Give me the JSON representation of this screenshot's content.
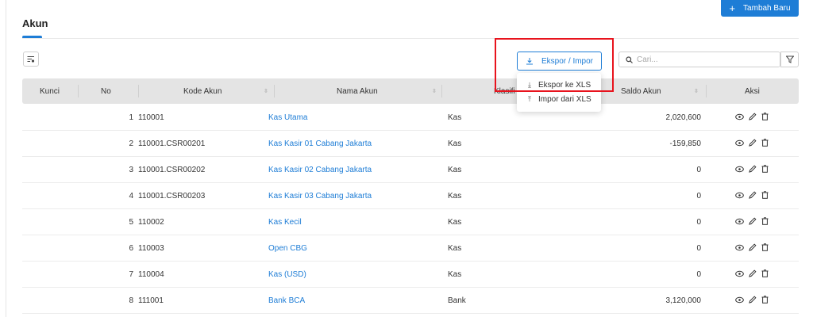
{
  "header": {
    "add_button_label": "Tambah Baru",
    "page_title": "Akun"
  },
  "toolbar": {
    "export_label": "Ekspor / Impor",
    "search_placeholder": "Cari..."
  },
  "dropdown": {
    "items": [
      {
        "label": "Ekspor ke XLS"
      },
      {
        "label": "Impor dari XLS"
      }
    ]
  },
  "table": {
    "columns": {
      "kunci": "Kunci",
      "no": "No",
      "kode": "Kode Akun",
      "nama": "Nama Akun",
      "klasifikasi": "Klasifi",
      "saldo": "Saldo Akun",
      "aksi": "Aksi"
    },
    "rows": [
      {
        "no": "1",
        "kode": "110001",
        "nama": "Kas Utama",
        "klasifikasi": "Kas",
        "saldo": "2,020,600"
      },
      {
        "no": "2",
        "kode": "110001.CSR00201",
        "nama": "Kas Kasir 01 Cabang Jakarta",
        "klasifikasi": "Kas",
        "saldo": "-159,850"
      },
      {
        "no": "3",
        "kode": "110001.CSR00202",
        "nama": "Kas Kasir 02 Cabang Jakarta",
        "klasifikasi": "Kas",
        "saldo": "0"
      },
      {
        "no": "4",
        "kode": "110001.CSR00203",
        "nama": "Kas Kasir 03 Cabang Jakarta",
        "klasifikasi": "Kas",
        "saldo": "0"
      },
      {
        "no": "5",
        "kode": "110002",
        "nama": "Kas Kecil",
        "klasifikasi": "Kas",
        "saldo": "0"
      },
      {
        "no": "6",
        "kode": "110003",
        "nama": "Open CBG",
        "klasifikasi": "Kas",
        "saldo": "0"
      },
      {
        "no": "7",
        "kode": "110004",
        "nama": "Kas (USD)",
        "klasifikasi": "Kas",
        "saldo": "0"
      },
      {
        "no": "8",
        "kode": "111001",
        "nama": "Bank BCA",
        "klasifikasi": "Bank",
        "saldo": "3,120,000"
      }
    ]
  },
  "colors": {
    "accent": "#1e7dd6",
    "highlight": "#e8131d",
    "header_bg": "#e4e4e4"
  },
  "icons": [
    "plus-icon",
    "filter-list-icon",
    "download-icon",
    "search-icon",
    "funnel-icon",
    "sort-icon",
    "export-icon",
    "import-icon",
    "eye-icon",
    "pencil-icon",
    "trash-icon"
  ]
}
